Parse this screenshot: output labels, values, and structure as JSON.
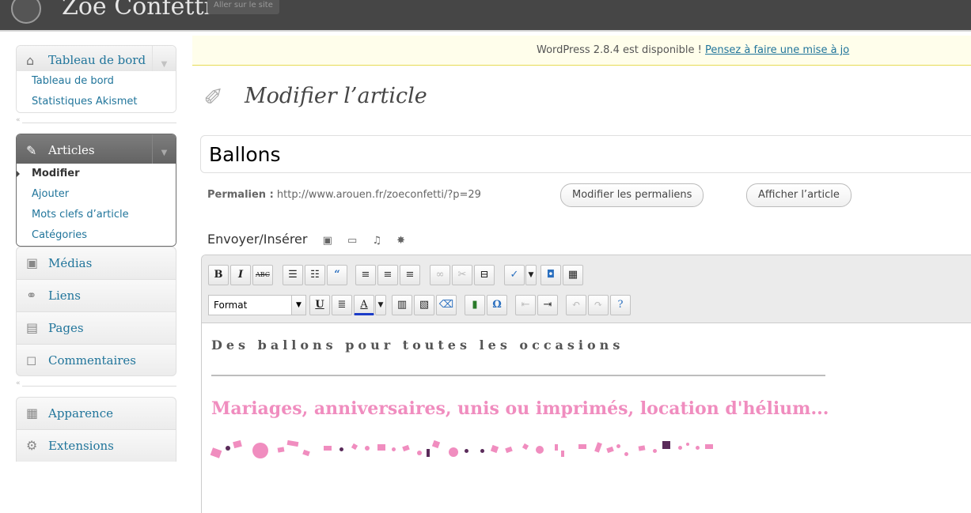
{
  "admin_bar": {
    "site_title": "Zoe Confetti",
    "visit_site": "Aller sur le site"
  },
  "nag": {
    "text": "WordPress 2.8.4 est disponible ! ",
    "link": "Pensez à faire une mise à jo"
  },
  "menu": {
    "dashboard": {
      "label": "Tableau de bord",
      "items": [
        "Tableau de bord",
        "Statistiques Akismet"
      ]
    },
    "articles": {
      "label": "Articles",
      "items": [
        "Modifier",
        "Ajouter",
        "Mots clefs d’article",
        "Catégories"
      ]
    },
    "medias": "Médias",
    "liens": "Liens",
    "pages": "Pages",
    "commentaires": "Commentaires",
    "apparence": "Apparence",
    "extensions": "Extensions"
  },
  "page": {
    "title": "Modifier l’article",
    "post_title": "Ballons",
    "permalink_label": "Permalien :",
    "permalink_url": " http://www.arouen.fr/zoeconfetti/?p=29",
    "edit_permalinks_button": "Modifier les permaliens",
    "view_post_button": "Afficher l’article",
    "upload_insert": "Envoyer/Insérer"
  },
  "toolbar": {
    "bold": "B",
    "italic": "I",
    "strike": "ABC",
    "format": "Format",
    "underline": "U",
    "text_color": "A",
    "omega": "Ω"
  },
  "editor_content": {
    "subtitle": "Des ballons pour toutes les occasions",
    "heading": "Mariages, anniversaires, unis ou imprimés, location d'hélium..."
  },
  "colors": {
    "accent_link": "#21759b",
    "pink": "#f08dbf",
    "admin_bar": "#464646"
  }
}
